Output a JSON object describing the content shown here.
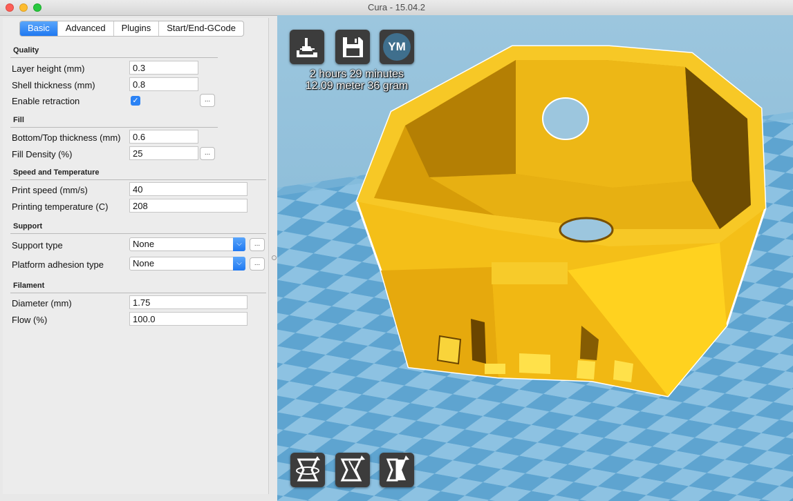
{
  "window": {
    "title": "Cura - 15.04.2"
  },
  "tabs": [
    {
      "label": "Basic",
      "active": true
    },
    {
      "label": "Advanced",
      "active": false
    },
    {
      "label": "Plugins",
      "active": false
    },
    {
      "label": "Start/End-GCode",
      "active": false
    }
  ],
  "quality": {
    "title": "Quality",
    "layer_height": {
      "label": "Layer height (mm)",
      "value": "0.3"
    },
    "shell_thickness": {
      "label": "Shell thickness (mm)",
      "value": "0.8"
    },
    "enable_retraction": {
      "label": "Enable retraction",
      "checked": true,
      "check_glyph": "✓"
    }
  },
  "fill": {
    "title": "Fill",
    "bottom_top_thickness": {
      "label": "Bottom/Top thickness (mm)",
      "value": "0.6"
    },
    "fill_density": {
      "label": "Fill Density (%)",
      "value": "25"
    }
  },
  "speed": {
    "title": "Speed and Temperature",
    "print_speed": {
      "label": "Print speed (mm/s)",
      "value": "40"
    },
    "printing_temperature": {
      "label": "Printing temperature (C)",
      "value": "208"
    }
  },
  "support": {
    "title": "Support",
    "support_type": {
      "label": "Support type",
      "value": "None"
    },
    "platform_adhesion": {
      "label": "Platform adhesion type",
      "value": "None"
    }
  },
  "filament": {
    "title": "Filament",
    "diameter": {
      "label": "Diameter (mm)",
      "value": "1.75"
    },
    "flow": {
      "label": "Flow (%)",
      "value": "100.0"
    }
  },
  "more_button_label": "...",
  "viewport": {
    "print_time": "2 hours 29 minutes",
    "print_material": "12.09 meter 36 gram",
    "ym_label": "YM",
    "icons": {
      "load": "load-model-icon",
      "save": "save-toolpath-icon",
      "ym": "ym-upload-icon",
      "rotate": "rotate-icon",
      "scale": "scale-icon",
      "mirror": "mirror-icon"
    }
  },
  "colors": {
    "accent": "#2a82f5",
    "model": "#f5c21b",
    "bed_light": "#8dc2e2",
    "bed_dark": "#5ea4d0",
    "toolbar_button": "#3c3c3c"
  }
}
